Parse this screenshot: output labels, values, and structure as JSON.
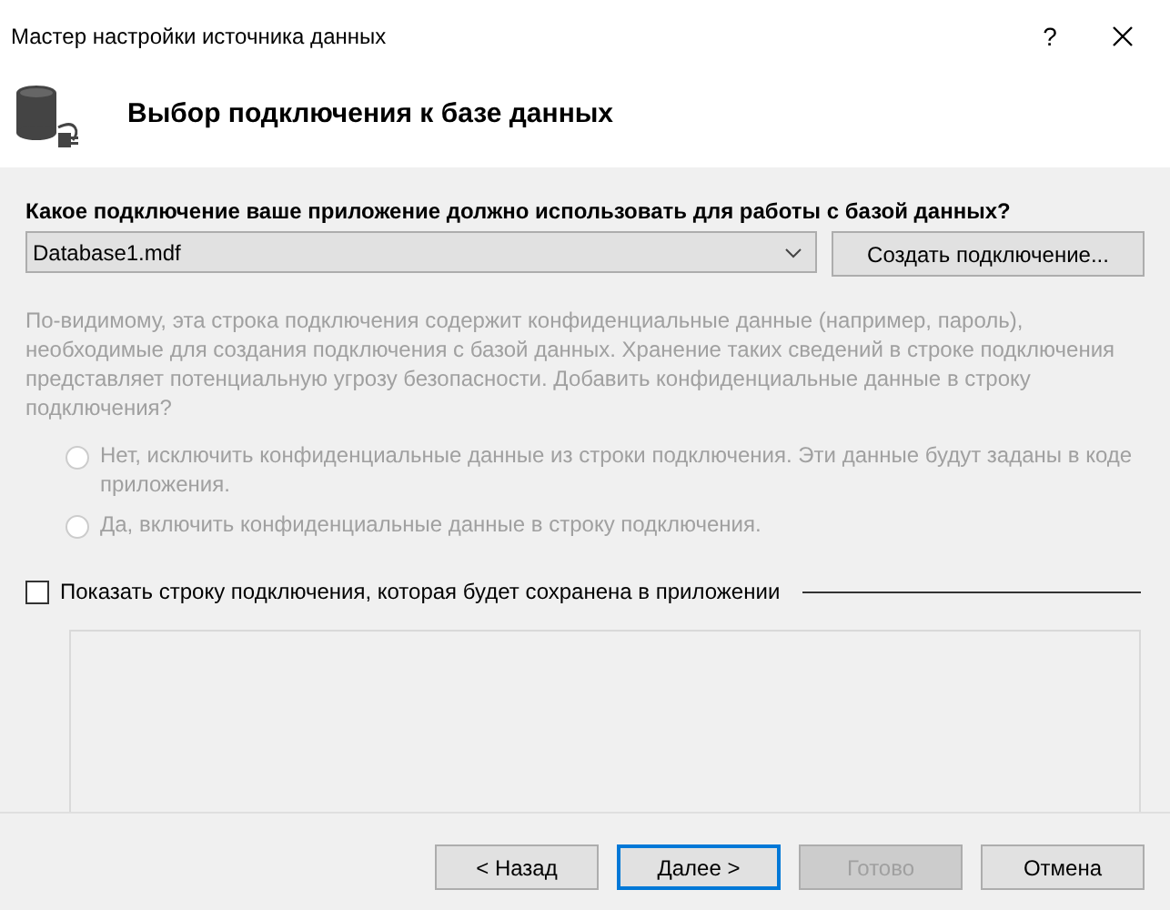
{
  "window": {
    "title": "Мастер настройки источника данных",
    "help": "?"
  },
  "header": {
    "title": "Выбор подключения к базе данных"
  },
  "connection": {
    "label": "Какое подключение ваше приложение должно использовать для работы с базой данных?",
    "value": "Database1.mdf",
    "new_button": "Создать подключение..."
  },
  "sensitive": {
    "disabled": true,
    "text": "По-видимому, эта строка подключения содержит конфиденциальные данные (например, пароль), необходимые для создания подключения с базой данных. Хранение таких сведений в строке подключения представляет потенциальную угрозу безопасности. Добавить конфиденциальные данные в строку подключения?",
    "options": [
      {
        "label": "Нет, исключить конфиденциальные данные из строки подключения. Эти данные будут заданы в коде приложения.",
        "selected": false
      },
      {
        "label": "Да, включить конфиденциальные данные в строку подключения.",
        "selected": false
      }
    ]
  },
  "show_string": {
    "label": "Показать строку подключения, которая будет сохранена в приложении",
    "checked": false
  },
  "buttons": [
    {
      "label": "< Назад",
      "disabled": false,
      "default": false
    },
    {
      "label": "Далее >",
      "disabled": false,
      "default": true
    },
    {
      "label": "Готово",
      "disabled": true,
      "default": false
    },
    {
      "label": "Отмена",
      "disabled": false,
      "default": false
    }
  ]
}
